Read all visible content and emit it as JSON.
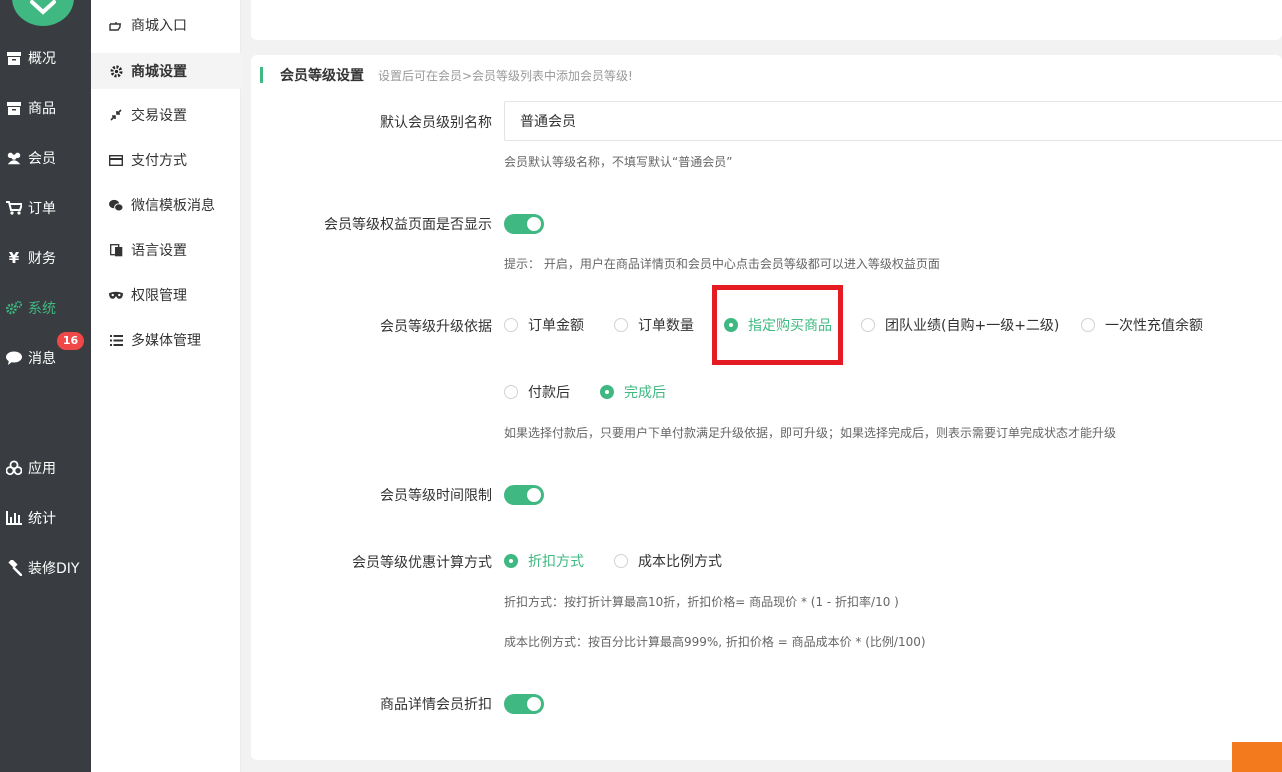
{
  "colors": {
    "accent": "#3fb882",
    "badge": "#f04848",
    "highlight": "#e41b23",
    "nav_bg": "#393d41"
  },
  "nav": {
    "items": [
      {
        "label": "概况",
        "icon": "archive-icon"
      },
      {
        "label": "商品",
        "icon": "archive-icon"
      },
      {
        "label": "会员",
        "icon": "users-icon"
      },
      {
        "label": "订单",
        "icon": "cart-icon"
      },
      {
        "label": "财务",
        "icon": "yen-icon"
      },
      {
        "label": "系统",
        "icon": "gears-icon",
        "active": true
      },
      {
        "label": "消息",
        "icon": "chat-icon",
        "badge": "16"
      },
      {
        "label": "应用",
        "icon": "cubes-icon"
      },
      {
        "label": "统计",
        "icon": "bar-chart-icon"
      },
      {
        "label": "装修DIY",
        "icon": "gavel-icon"
      }
    ]
  },
  "submenu": {
    "items": [
      {
        "label": "商城入口",
        "icon": "pointer-hand-icon"
      },
      {
        "label": "商城设置",
        "icon": "gear-icon",
        "active": true
      },
      {
        "label": "交易设置",
        "icon": "compress-icon"
      },
      {
        "label": "支付方式",
        "icon": "credit-card-icon"
      },
      {
        "label": "微信模板消息",
        "icon": "wechat-icon"
      },
      {
        "label": "语言设置",
        "icon": "translate-icon"
      },
      {
        "label": "权限管理",
        "icon": "mask-icon"
      },
      {
        "label": "多媒体管理",
        "icon": "list-icon"
      }
    ]
  },
  "section": {
    "title": "会员等级设置",
    "hint": "设置后可在会员>会员等级列表中添加会员等级!"
  },
  "form": {
    "default_level": {
      "label": "默认会员级别名称",
      "value": "普通会员",
      "hint": "会员默认等级名称，不填写默认“普通会员”"
    },
    "rights_page": {
      "label": "会员等级权益页面是否显示",
      "enabled": true,
      "hint": "提示： 开启，用户在商品详情页和会员中心点击会员等级都可以进入等级权益页面"
    },
    "upgrade_basis": {
      "label": "会员等级升级依据",
      "options": [
        "订单金额",
        "订单数量",
        "指定购买商品",
        "团队业绩(自购+一级+二级)",
        "一次性充值余额"
      ],
      "selected": "指定购买商品"
    },
    "upgrade_timing": {
      "options": [
        "付款后",
        "完成后"
      ],
      "selected": "完成后",
      "hint": "如果选择付款后，只要用户下单付款满足升级依据，即可升级；如果选择完成后，则表示需要订单完成状态才能升级"
    },
    "time_limit": {
      "label": "会员等级时间限制",
      "enabled": true
    },
    "discount_calc": {
      "label": "会员等级优惠计算方式",
      "options": [
        "折扣方式",
        "成本比例方式"
      ],
      "selected": "折扣方式",
      "hint_1": "折扣方式：按打折计算最高10折，折扣价格= 商品现价 * (1 - 折扣率/10 )",
      "hint_2": "成本比例方式：按百分比计算最高999%, 折扣价格 = 商品成本价 * (比例/100)"
    },
    "detail_discount": {
      "label": "商品详情会员折扣",
      "enabled": true
    }
  }
}
